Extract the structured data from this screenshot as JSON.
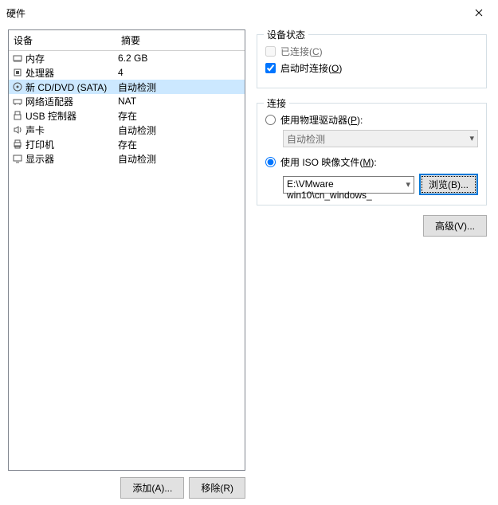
{
  "title": "硬件",
  "list_header": {
    "device": "设备",
    "summary": "摘要"
  },
  "devices": [
    {
      "name": "内存",
      "summary": "6.2 GB",
      "icon": "memory"
    },
    {
      "name": "处理器",
      "summary": "4",
      "icon": "cpu"
    },
    {
      "name": "新 CD/DVD (SATA)",
      "summary": "自动检测",
      "icon": "cd",
      "selected": true
    },
    {
      "name": "网络适配器",
      "summary": "NAT",
      "icon": "net"
    },
    {
      "name": "USB 控制器",
      "summary": "存在",
      "icon": "usb"
    },
    {
      "name": "声卡",
      "summary": "自动检测",
      "icon": "sound"
    },
    {
      "name": "打印机",
      "summary": "存在",
      "icon": "printer"
    },
    {
      "name": "显示器",
      "summary": "自动检测",
      "icon": "display"
    }
  ],
  "buttons": {
    "add": "添加(A)...",
    "remove": "移除(R)"
  },
  "status": {
    "title": "设备状态",
    "connected_label_pre": "已连接(",
    "connected_label_key": "C",
    "connected_label_post": ")",
    "startup_label_pre": "启动时连接(",
    "startup_label_key": "O",
    "startup_label_post": ")"
  },
  "connection": {
    "title": "连接",
    "physical_label_pre": "使用物理驱动器(",
    "physical_label_key": "P",
    "physical_label_post": "):",
    "physical_combo": "自动检测",
    "iso_label_pre": "使用 ISO 映像文件(",
    "iso_label_key": "M",
    "iso_label_post": "):",
    "iso_path": "E:\\VMware win10\\cn_windows_",
    "browse": "浏览(B)..."
  },
  "advanced": "高级(V)..."
}
